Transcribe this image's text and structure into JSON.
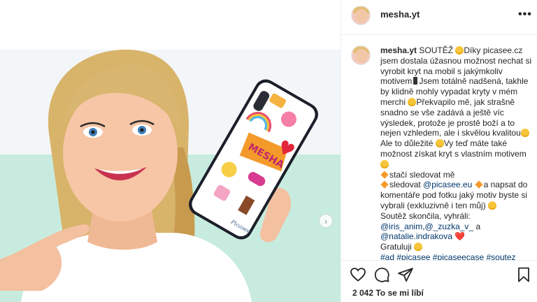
{
  "post": {
    "username": "mesha.yt",
    "more_icon": "more-horizontal-icon",
    "next_icon": "chevron-right-icon"
  },
  "photo": {
    "phone_sticker_text": "MESHA",
    "signature": "Picasee"
  },
  "caption": {
    "username": "mesha.yt",
    "lines": [
      [
        "SOUTĚŽ ",
        "emoji:yellow",
        "Díky picasee.cz jsem dostala úžasnou možnost nechat si vyrobit kryt na mobil s jakýmkoliv motivem",
        "emoji:phone",
        "Jsem totálně nadšená, takhle by klidně mohly vypadat kryty v mém merchi ",
        "emoji:yellow",
        "Překvapilo mě, jak strašně snadno se vše zadává a ještě víc výsledek, protože je prostě boží a to nejen vzhledem, ale i skvělou kvalitou",
        "emoji:yellow",
        " Ale to důležité ",
        "emoji:yellow",
        "Vy teď máte také možnost získat kryt s vlastním motivem ",
        "emoji:yellow"
      ]
    ],
    "p2_part1": "stačí sledovat mě",
    "p3_part1": "sledovat ",
    "p3_mention": "@picasee.eu",
    "p3_part2": "a napsat do komentáře pod fotku jaký motiv byste si vybrali (exkluzivně i ten můj) ",
    "p4_part1": "Soutěž skončila, vyhráli: ",
    "p4_m1": "@iris_anim",
    "p4_sep1": ",",
    "p4_m2": "@_zuzka_v_",
    "p4_sep2": " a ",
    "p4_m3": "@natalie.indrakova",
    "p4_heart": "❤️",
    "p5": "Gratuluji ",
    "hashtags": [
      "#ad",
      "#picasee",
      "#picaseecase",
      "#soutez"
    ]
  },
  "actions": {
    "like_icon": "heart-icon",
    "comment_icon": "comment-icon",
    "share_icon": "paper-plane-icon",
    "save_icon": "bookmark-icon",
    "likes_text": "2 042 To se mi líbí"
  },
  "colors": {
    "link": "#00376b",
    "text": "#262626",
    "border": "#efefef",
    "accent_sticker": "#f39a2b"
  }
}
